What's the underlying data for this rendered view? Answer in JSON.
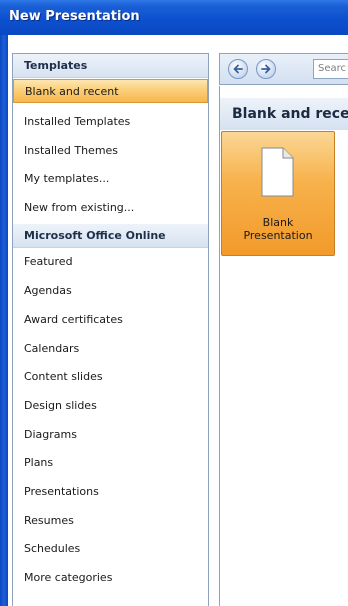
{
  "window": {
    "title": "New Presentation"
  },
  "sidebar": {
    "items": [
      {
        "label": "Templates",
        "type": "header"
      },
      {
        "label": "Blank and recent",
        "type": "selected"
      },
      {
        "label": "Installed Templates",
        "type": "item"
      },
      {
        "label": "Installed Themes",
        "type": "item"
      },
      {
        "label": "My templates...",
        "type": "item"
      },
      {
        "label": "New from existing...",
        "type": "item"
      },
      {
        "label": "Microsoft Office Online",
        "type": "header"
      },
      {
        "label": "Featured",
        "type": "item"
      },
      {
        "label": "Agendas",
        "type": "item"
      },
      {
        "label": "Award certificates",
        "type": "item"
      },
      {
        "label": "Calendars",
        "type": "item"
      },
      {
        "label": "Content slides",
        "type": "item"
      },
      {
        "label": "Design slides",
        "type": "item"
      },
      {
        "label": "Diagrams",
        "type": "item"
      },
      {
        "label": "Plans",
        "type": "item"
      },
      {
        "label": "Presentations",
        "type": "item"
      },
      {
        "label": "Resumes",
        "type": "item"
      },
      {
        "label": "Schedules",
        "type": "item"
      },
      {
        "label": "More categories",
        "type": "item"
      }
    ]
  },
  "nav": {
    "back_icon": "back-arrow-icon",
    "forward_icon": "forward-arrow-icon",
    "search_placeholder": "Searc"
  },
  "main": {
    "section_title": "Blank and recent",
    "tiles": [
      {
        "label_line1": "Blank",
        "label_line2": "Presentation",
        "icon": "blank-document-icon"
      }
    ]
  },
  "colors": {
    "titlebar": "#0d50cf",
    "selection": "#f8b64c",
    "header_bg": "#d7e2f1"
  }
}
